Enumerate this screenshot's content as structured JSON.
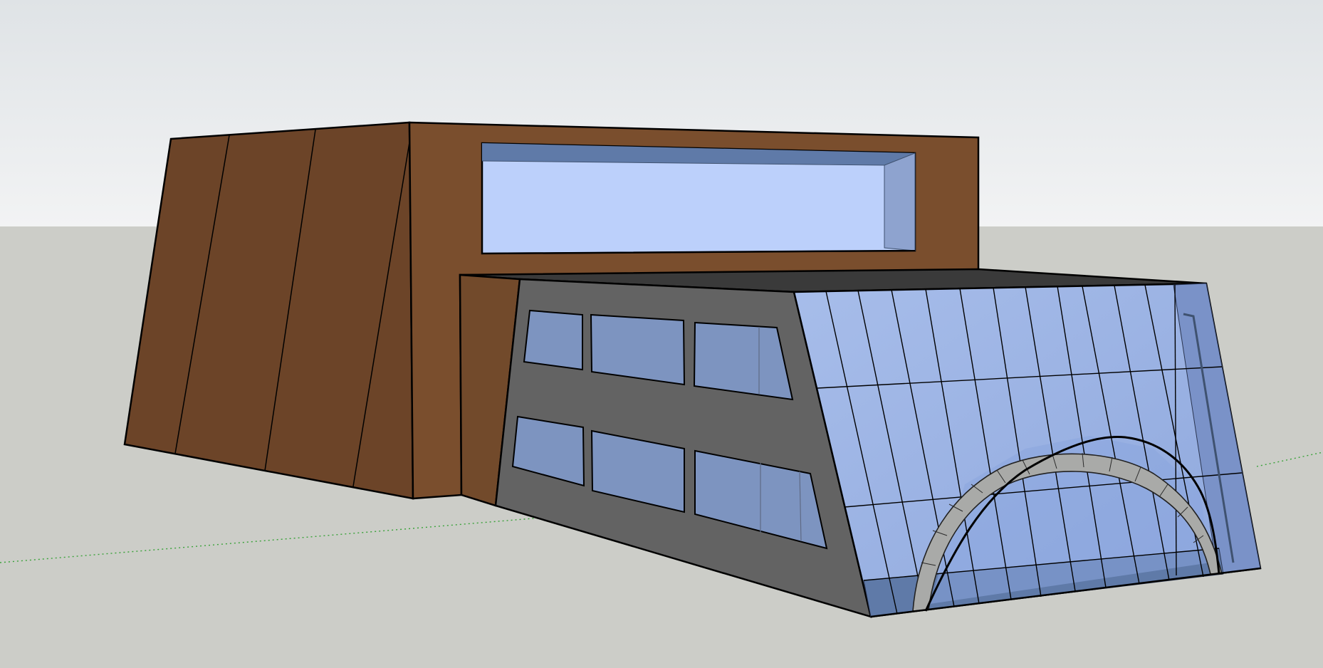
{
  "app": {
    "view": "3d-model-viewport",
    "camera": "perspective"
  },
  "scene": {
    "sky_colors": [
      "#dfe3e6",
      "#f2f3f4"
    ],
    "ground_color": "#cccdc8",
    "axis_color": "#3aa23a",
    "materials": {
      "wood_dark": "#6c4428",
      "wood": "#7a4e2d",
      "wood_side": "#724a2b",
      "concrete": "#636363",
      "roof": "#3a3a3a",
      "glass": "#9ab0e2",
      "glass_light": "#bcd0fb",
      "glass_dark": "#5f7aa8",
      "window": "#7d94c0",
      "arch": "#a9aaa8",
      "edge": "#000000"
    }
  }
}
